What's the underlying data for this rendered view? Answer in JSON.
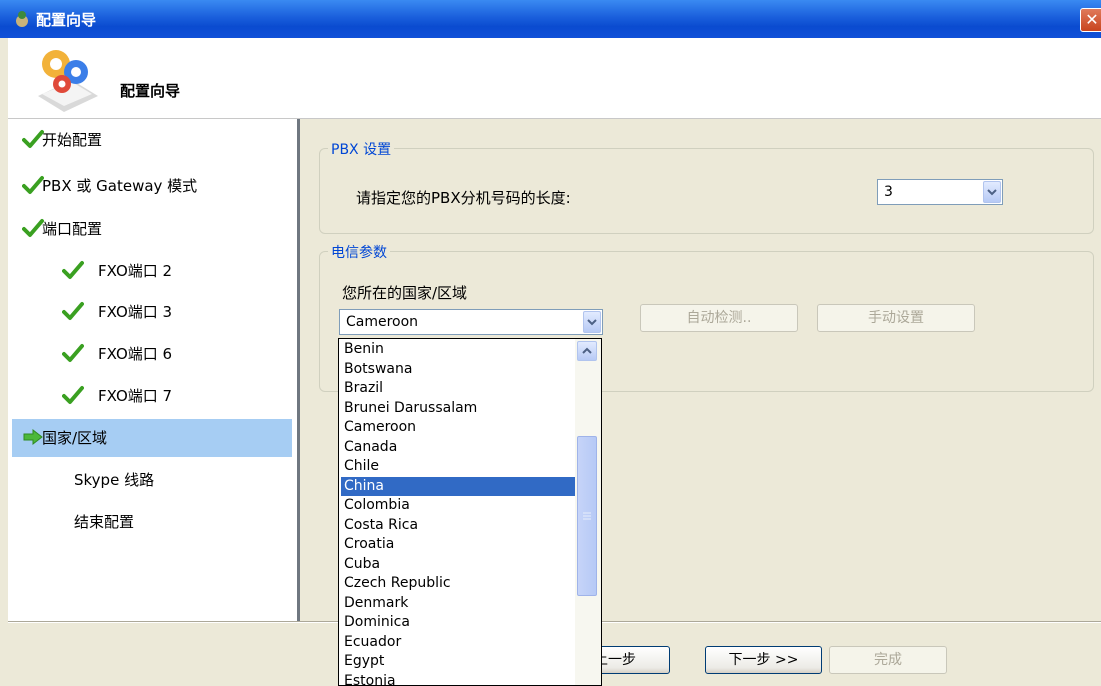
{
  "window": {
    "title": "配置向导",
    "close_glyph": "✕"
  },
  "header": {
    "title": "配置向导"
  },
  "nav": {
    "items": [
      {
        "label": "开始配置",
        "status": "done"
      },
      {
        "label": "PBX 或 Gateway 模式",
        "status": "done"
      },
      {
        "label": "端口配置",
        "status": "done"
      },
      {
        "label": "FXO端口 2",
        "status": "done"
      },
      {
        "label": "FXO端口 3",
        "status": "done"
      },
      {
        "label": "FXO端口 6",
        "status": "done"
      },
      {
        "label": "FXO端口 7",
        "status": "done"
      },
      {
        "label": "国家/区域",
        "status": "current"
      },
      {
        "label": "Skype 线路",
        "status": "pending"
      },
      {
        "label": "结束配置",
        "status": "pending"
      }
    ]
  },
  "pbx": {
    "group_title": "PBX 设置",
    "ext_length_label": "请指定您的PBX分机号码的长度:",
    "ext_length_value": "3"
  },
  "telecom": {
    "group_title": "电信参数",
    "country_label": "您所在的国家/区域",
    "country_value": "Cameroon",
    "auto_detect_label": "自动检测..",
    "manual_label": "手动设置"
  },
  "country_list": {
    "items": [
      "Benin",
      "Botswana",
      "Brazil",
      "Brunei Darussalam",
      "Cameroon",
      "Canada",
      "Chile",
      "China",
      "Colombia",
      "Costa Rica",
      "Croatia",
      "Cuba",
      "Czech Republic",
      "Denmark",
      "Dominica",
      "Ecuador",
      "Egypt",
      "Estonia"
    ],
    "highlighted": "China"
  },
  "footer": {
    "back_label": "上一步",
    "next_label": "下一步 >>",
    "finish_label": "完成"
  },
  "colors": {
    "accent": "#316ac5",
    "nav_selected": "#a6cdf3",
    "group_title": "#0046d5",
    "check": "#3aa021"
  }
}
